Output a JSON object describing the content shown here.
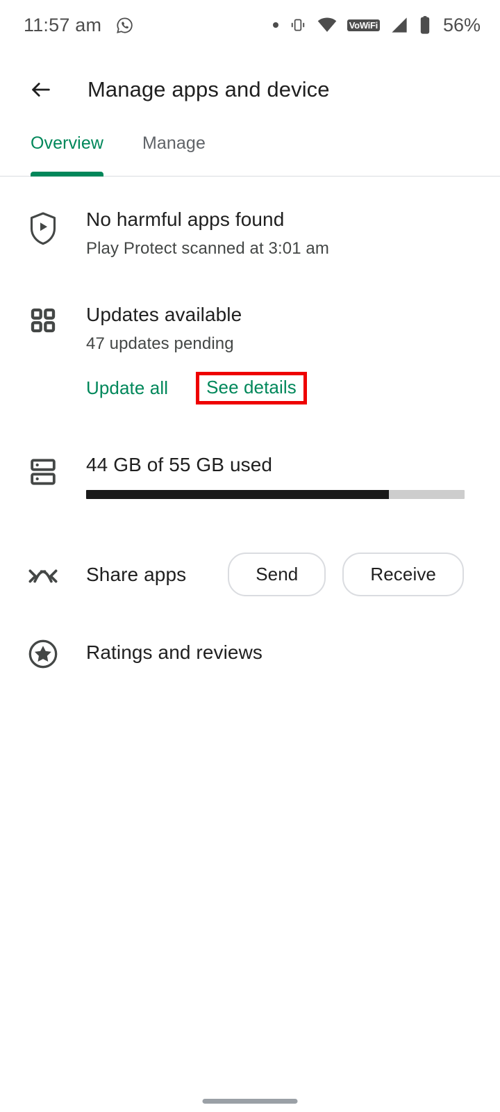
{
  "status_bar": {
    "time": "11:57 am",
    "battery_percent": "56%",
    "icons": [
      "whatsapp-icon",
      "dot-icon",
      "vibrate-icon",
      "wifi-icon",
      "vowifi-icon",
      "signal-icon",
      "battery-icon"
    ],
    "vowifi_label": "VoWiFi"
  },
  "app_bar": {
    "back_label": "Back",
    "title": "Manage apps and device"
  },
  "tabs": [
    {
      "label": "Overview",
      "active": true
    },
    {
      "label": "Manage",
      "active": false
    }
  ],
  "rows": {
    "play_protect": {
      "icon": "shield-play-icon",
      "title": "No harmful apps found",
      "subtitle": "Play Protect scanned at 3:01 am"
    },
    "updates": {
      "icon": "apps-grid-icon",
      "title": "Updates available",
      "subtitle": "47 updates pending",
      "update_all_label": "Update all",
      "see_details_label": "See details"
    },
    "storage": {
      "icon": "storage-icon",
      "title": "44 GB of 55 GB used",
      "used_gb": 44,
      "total_gb": 55,
      "percent_used": 80
    },
    "share": {
      "icon": "share-apps-icon",
      "title": "Share apps",
      "send_label": "Send",
      "receive_label": "Receive"
    },
    "ratings": {
      "icon": "star-circle-icon",
      "title": "Ratings and reviews"
    }
  },
  "colors": {
    "accent_green": "#00875a",
    "highlight_red": "#ee0000",
    "text_primary": "#1f1f1f",
    "text_secondary": "#444746",
    "progress_fill": "#1a1a1a",
    "progress_track": "#cdcdcd"
  },
  "nav": {
    "gesture_pill": "home-gesture-bar"
  }
}
